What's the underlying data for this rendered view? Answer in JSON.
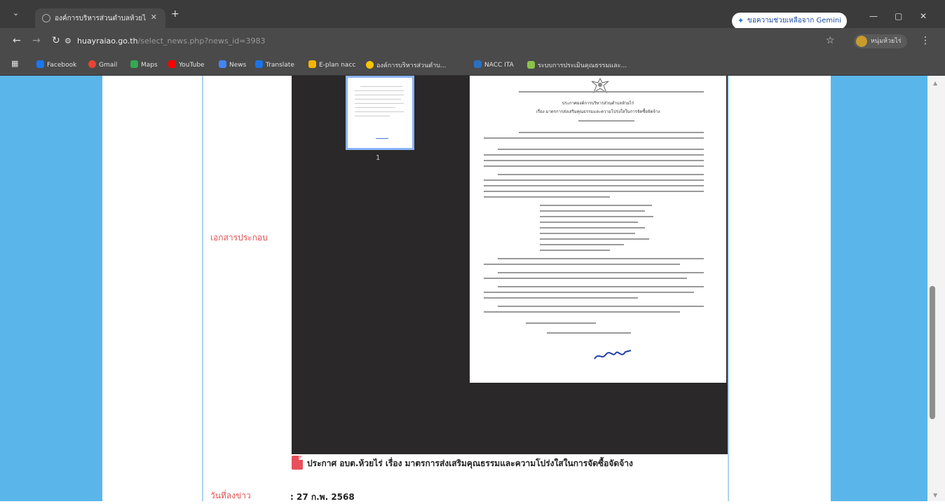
{
  "browser": {
    "tab_title": "องค์การบริหารส่วนตำบลห้วยไร่",
    "gemini_label": "ขอความช่วยเหลือจาก Gemini",
    "url_host": "huayraiao.go.th",
    "url_path": "/select_news.php?news_id=3983",
    "profile_name": "หนุ่มห้วยไร่",
    "bookmarks": [
      "Facebook",
      "Gmail",
      "Maps",
      "YouTube",
      "News",
      "Translate",
      "E-plan nacc",
      "องค์การบริหารส่วนตำบ...",
      "NACC ITA",
      "ระบบการประเมินคุณธรรมและ..."
    ]
  },
  "page": {
    "attachment_label": "เอกสารประกอบ",
    "thumbnail_page_number": "1",
    "doc_title_line1": "ประกาศองค์การบริหารส่วนตำบลห้วยไร่",
    "doc_title_line2": "เรื่อง มาตรการส่งเสริมคุณธรรมและความโปร่งใสในการจัดซื้อจัดจ้าง",
    "pdf_link_text": "ประกาศ อบต.ห้วยไร่ เรื่อง มาตรการส่งเสริมคุณธรรมและความโปร่งใสในการจัดซื้อจัดจ้าง",
    "news_date_label": "วันที่ลงข่าว",
    "news_date_value": ": 27 ก.พ. 2568"
  },
  "colors": {
    "side_background": "#5ab6ea",
    "viewer_background": "#2a2828",
    "label_red": "#e05252",
    "pdf_icon": "#e8505b"
  }
}
